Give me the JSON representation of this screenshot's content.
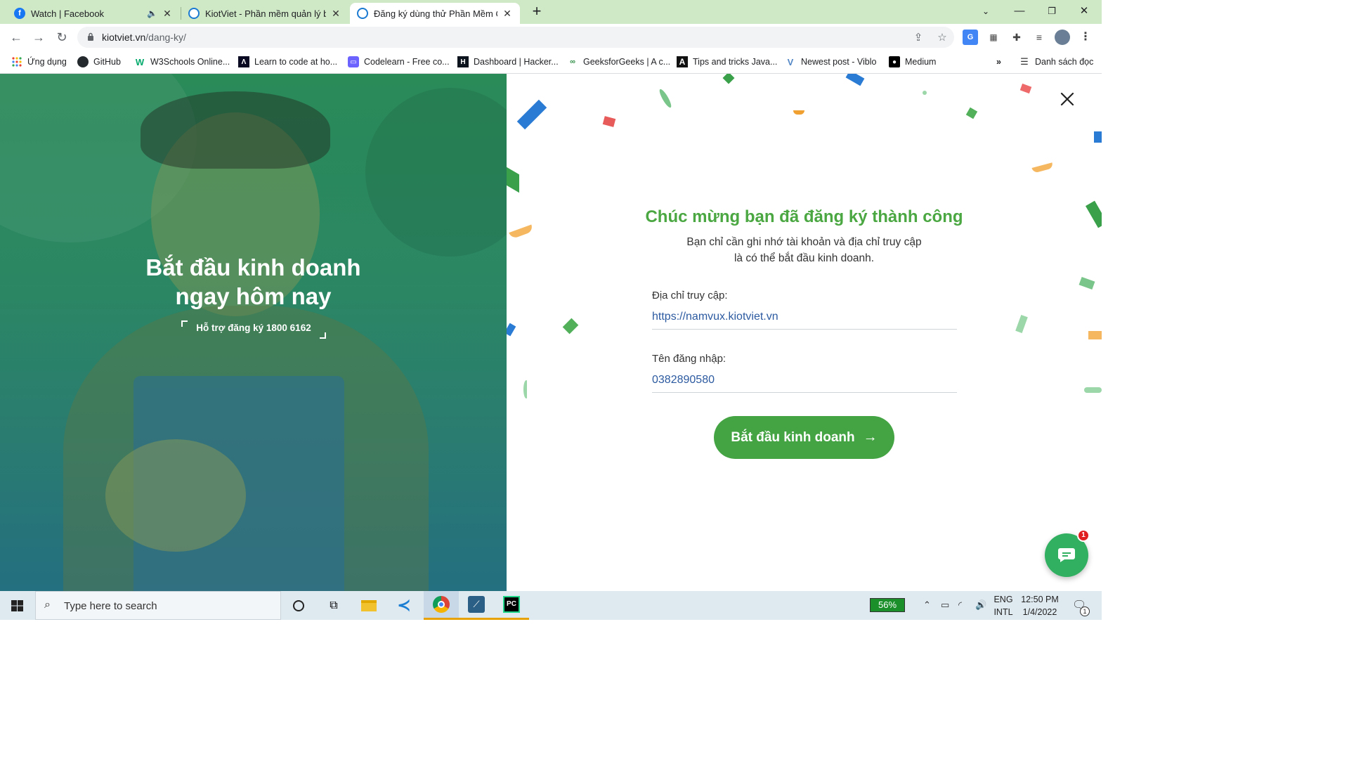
{
  "browser": {
    "tabs": [
      {
        "title": "Watch | Facebook",
        "icon": "facebook-icon",
        "audio": true,
        "active": false
      },
      {
        "title": "KiotViet - Phần mềm quản lý bán",
        "icon": "kiotviet-icon",
        "active": false
      },
      {
        "title": "Đăng ký dùng thử Phần Mềm Qu",
        "icon": "kiotviet-icon",
        "active": true
      }
    ],
    "address": {
      "domain": "kiotviet.vn",
      "path": "/dang-ky/"
    },
    "bookmarks": [
      {
        "label": "Ứng dụng",
        "icon": "apps-grid-icon"
      },
      {
        "label": "GitHub",
        "icon": "github-icon"
      },
      {
        "label": "W3Schools Online...",
        "icon": "w3schools-icon"
      },
      {
        "label": "Learn to code at ho...",
        "icon": "freecodecamp-icon"
      },
      {
        "label": "Codelearn - Free co...",
        "icon": "codelearn-icon"
      },
      {
        "label": "Dashboard | Hacker...",
        "icon": "hackerrank-icon"
      },
      {
        "label": "GeeksforGeeks | A c...",
        "icon": "geeksforgeeks-icon"
      },
      {
        "label": "Tips and tricks Java...",
        "icon": "tips-icon"
      },
      {
        "label": "Newest post - Viblo",
        "icon": "viblo-icon"
      },
      {
        "label": "Medium",
        "icon": "medium-icon"
      }
    ],
    "overflow": "»",
    "reading_list": "Danh sách đọc"
  },
  "hero": {
    "title_line1": "Bắt đầu kinh doanh",
    "title_line2": "ngay hôm nay",
    "support": "Hỗ trợ đăng ký 1800 6162"
  },
  "panel": {
    "title": "Chúc mừng bạn đã đăng ký thành công",
    "desc_line1": "Bạn chỉ cần ghi nhớ tài khoản và địa chỉ truy cập",
    "desc_line2": "là có thể bắt đầu kinh doanh.",
    "address_label": "Địa chỉ truy cập:",
    "address_value": "https://namvux.kiotviet.vn",
    "username_label": "Tên đăng nhập:",
    "username_value": "0382890580",
    "start_button": "Bắt đầu kinh doanh",
    "chat_badge": "1"
  },
  "taskbar": {
    "search_placeholder": "Type here to search",
    "battery": "56%",
    "lang_top": "ENG",
    "lang_bottom": "INTL",
    "time": "12:50 PM",
    "date": "1/4/2022",
    "notification_count": "1"
  },
  "colors": {
    "accent_green": "#44a343",
    "title_green": "#4aa741",
    "link_blue": "#2c5aa0",
    "tab_strip": "#cfe8c6"
  }
}
